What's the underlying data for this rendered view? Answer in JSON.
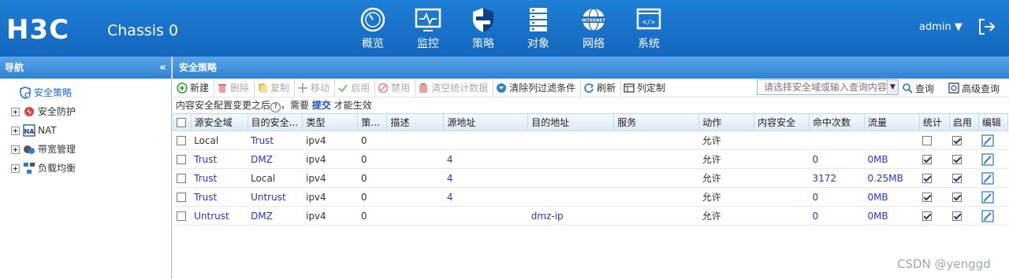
{
  "header": {
    "logo": "H3C",
    "device": "Chassis 0",
    "user": "admin",
    "nav": [
      {
        "label": "概览",
        "icon": "dashboard-icon"
      },
      {
        "label": "监控",
        "icon": "monitor-icon"
      },
      {
        "label": "策略",
        "icon": "shield-icon"
      },
      {
        "label": "对象",
        "icon": "server-list-icon"
      },
      {
        "label": "网络",
        "icon": "internet-globe-icon"
      },
      {
        "label": "系统",
        "icon": "code-window-icon"
      }
    ]
  },
  "sidebar": {
    "title": "导航",
    "collapse": "«",
    "items": [
      {
        "label": "安全策略",
        "icon": "security-policy-icon"
      },
      {
        "label": "安全防护",
        "icon": "protection-icon"
      },
      {
        "label": "NAT",
        "icon": "nat-icon"
      },
      {
        "label": "带宽管理",
        "icon": "bandwidth-icon"
      },
      {
        "label": "负载均衡",
        "icon": "load-balance-icon"
      }
    ]
  },
  "main": {
    "title": "安全策略",
    "toolbar": {
      "new": "新建",
      "delete": "删除",
      "copy": "复制",
      "move": "移动",
      "enable": "启用",
      "disable": "禁用",
      "clear_stats": "清空统计数据",
      "clear_filter": "清除列过滤条件",
      "refresh": "刷新",
      "custom_cols": "列定制",
      "search_placeholder": "请选择安全域或输入查询内容",
      "query": "查询",
      "advanced_query": "高级查询"
    },
    "notice": {
      "prefix": "内容安全配置变更之后",
      "q": "?",
      "middle": "，需要",
      "submit": "提交",
      "suffix": "才能生效"
    },
    "columns": [
      "源安全域",
      "目的安全...",
      "类型",
      "策...",
      "描述",
      "源地址",
      "目的地址",
      "服务",
      "动作",
      "内容安全",
      "命中次数",
      "流量",
      "统计",
      "启用",
      "编辑"
    ],
    "rows": [
      {
        "src_zone": "Local",
        "dst_zone": "Trust",
        "type": "ipv4",
        "id": "0",
        "desc": "",
        "src_addr": "",
        "dst_addr": "",
        "service": "",
        "action": "允许",
        "content_sec": "",
        "hits": "",
        "traffic": "",
        "stats": false,
        "enabled": true
      },
      {
        "src_zone": "Trust",
        "dst_zone": "DMZ",
        "type": "ipv4",
        "id": "0",
        "desc": "",
        "src_addr": "4",
        "dst_addr": "",
        "service": "",
        "action": "允许",
        "content_sec": "",
        "hits": "0",
        "traffic": "0MB",
        "stats": true,
        "enabled": true
      },
      {
        "src_zone": "Trust",
        "dst_zone": "Local",
        "type": "ipv4",
        "id": "0",
        "desc": "",
        "src_addr": "4",
        "dst_addr": "",
        "service": "",
        "action": "允许",
        "content_sec": "",
        "hits": "3172",
        "traffic": "0.25MB",
        "stats": true,
        "enabled": true
      },
      {
        "src_zone": "Trust",
        "dst_zone": "Untrust",
        "type": "ipv4",
        "id": "0",
        "desc": "",
        "src_addr": "4",
        "dst_addr": "",
        "service": "",
        "action": "允许",
        "content_sec": "",
        "hits": "0",
        "traffic": "0MB",
        "stats": true,
        "enabled": true
      },
      {
        "src_zone": "Untrust",
        "dst_zone": "DMZ",
        "type": "ipv4",
        "id": "0",
        "desc": "",
        "src_addr": "",
        "dst_addr": "dmz-ip",
        "service": "",
        "action": "允许",
        "content_sec": "",
        "hits": "0",
        "traffic": "0MB",
        "stats": true,
        "enabled": true
      }
    ]
  },
  "watermark": "CSDN @yenggd"
}
